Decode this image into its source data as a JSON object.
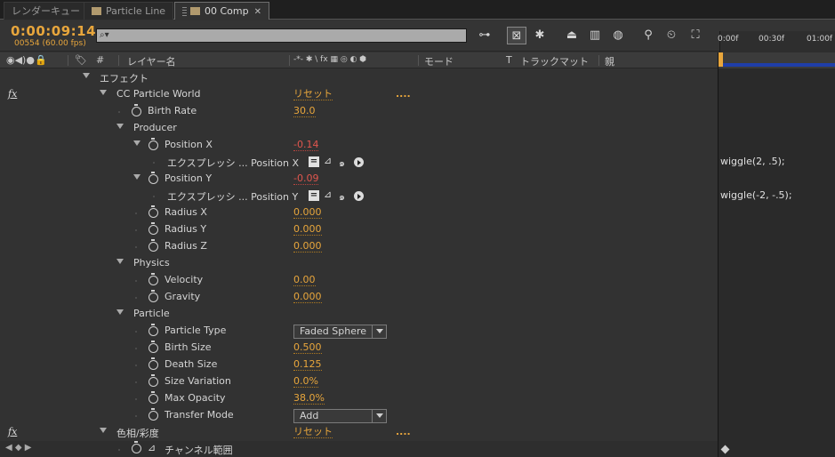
{
  "tabs": [
    {
      "label": "レンダーキュー"
    },
    {
      "label": "Particle Line"
    },
    {
      "label": "00 Comp"
    }
  ],
  "header": {
    "timecode": "0:00:09:14",
    "frames": "00554 (60.00 fps)",
    "search_placeholder": "",
    "search_glyph": "⌕▾"
  },
  "ruler": {
    "labels": [
      "0:00f",
      "00:30f",
      "01:00f"
    ]
  },
  "columns": {
    "hash": "#",
    "layer_name": "レイヤー名",
    "switches": "-*- ✱ \\ fx ▦ ◎ ◐ ⬢",
    "mode": "モード",
    "t": "T",
    "trackmatte": "トラックマット",
    "parent": "親"
  },
  "rows": [
    {
      "id": "effects",
      "label": "エフェクト"
    },
    {
      "id": "ccpw",
      "fx": "fx",
      "label": "CC Particle World",
      "value": "リセット",
      "dots": "...."
    },
    {
      "id": "birthrate",
      "label": "Birth Rate",
      "value": "30.0"
    },
    {
      "id": "producer",
      "label": "Producer"
    },
    {
      "id": "posx",
      "label": "Position X",
      "value": "-0.14"
    },
    {
      "id": "exprx",
      "label": "エクスプレッシ ... Position X",
      "eq": "="
    },
    {
      "id": "posy",
      "label": "Position Y",
      "value": "-0.09"
    },
    {
      "id": "expry",
      "label": "エクスプレッシ ... Position Y",
      "eq": "="
    },
    {
      "id": "radiusx",
      "label": "Radius X",
      "value": "0.000"
    },
    {
      "id": "radiusy",
      "label": "Radius Y",
      "value": "0.000"
    },
    {
      "id": "radiusz",
      "label": "Radius Z",
      "value": "0.000"
    },
    {
      "id": "physics",
      "label": "Physics"
    },
    {
      "id": "velocity",
      "label": "Velocity",
      "value": "0.00"
    },
    {
      "id": "gravity",
      "label": "Gravity",
      "value": "0.000"
    },
    {
      "id": "particle",
      "label": "Particle"
    },
    {
      "id": "ptype",
      "label": "Particle Type",
      "dropdown": "Faded Sphere"
    },
    {
      "id": "birthsize",
      "label": "Birth Size",
      "value": "0.500"
    },
    {
      "id": "deathsize",
      "label": "Death Size",
      "value": "0.125"
    },
    {
      "id": "sizevar",
      "label": "Size Variation",
      "value": "0.0%"
    },
    {
      "id": "maxop",
      "label": "Max Opacity",
      "value": "38.0%"
    },
    {
      "id": "transfer",
      "label": "Transfer Mode",
      "dropdown": "Add"
    },
    {
      "id": "huesat",
      "fx": "fx",
      "label": "色相/彩度",
      "value": "リセット",
      "dots": "...."
    },
    {
      "id": "channel",
      "label": "チャンネル範囲"
    }
  ],
  "expressions": {
    "x": "wiggle(2, .5);",
    "y": "wiggle(-2, -.5);"
  }
}
